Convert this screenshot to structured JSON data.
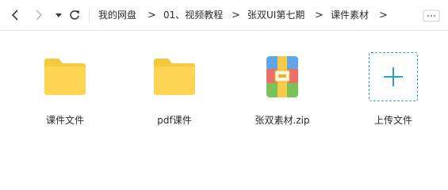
{
  "breadcrumb": {
    "items": [
      "我的网盘",
      "01、视频教程",
      "张双UI第七期",
      "课件素材"
    ],
    "separator": ">"
  },
  "toolbar": {
    "back_icon": "chevron-left-icon",
    "forward_icon": "chevron-right-icon",
    "history_icon": "caret-down-icon",
    "refresh_icon": "refresh-icon",
    "more_icon": "more-icon"
  },
  "files": [
    {
      "name": "课件文件",
      "type": "folder"
    },
    {
      "name": "pdf课件",
      "type": "folder"
    },
    {
      "name": "张双素材.zip",
      "type": "zip"
    }
  ],
  "upload": {
    "label": "上传文件"
  },
  "colors": {
    "folder": "#FFD452",
    "folder_tab": "#F5C93E",
    "accent": "#29A0C3",
    "zip_blue": "#5EA6E8",
    "zip_red": "#EE6F68",
    "zip_green": "#79C257",
    "zip_yellow": "#F6C946"
  }
}
